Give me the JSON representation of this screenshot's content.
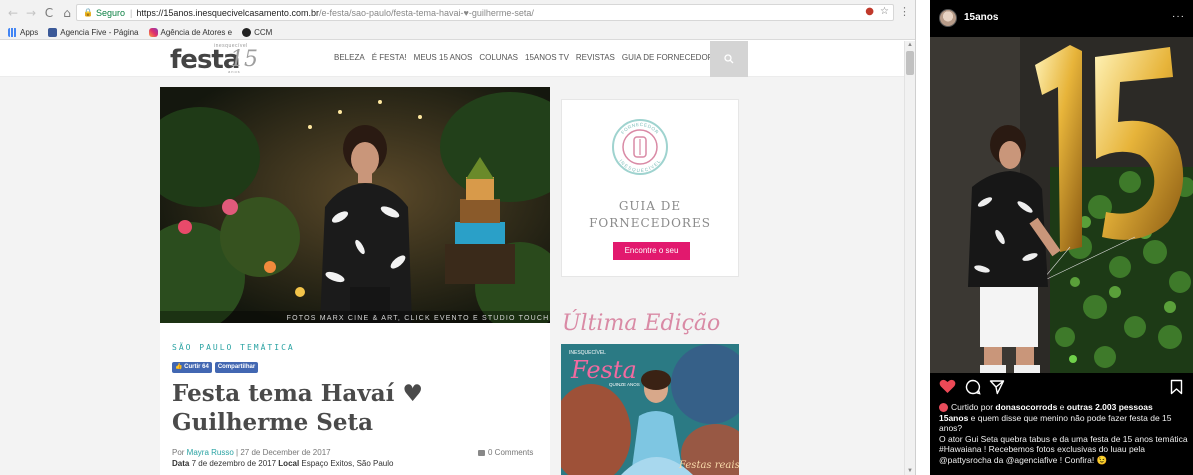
{
  "browser": {
    "nav": {
      "back": "←",
      "forward": "→",
      "reload": "C",
      "home": "⌂"
    },
    "omnibox": {
      "secure_label": "Seguro",
      "url_host": "https://15anos.inesquecivelcasamento.com.br",
      "url_path": "/e-festa/sao-paulo/festa-tema-havai-♥-guilherme-seta/"
    },
    "bookmarks": [
      {
        "label": "Apps",
        "icon": "apps-grid-icon"
      },
      {
        "label": "Agencia Five - Página",
        "icon": "facebook-icon"
      },
      {
        "label": "Agência de Atores e",
        "icon": "instagram-icon"
      },
      {
        "label": "CCM",
        "icon": "ccm-icon"
      }
    ]
  },
  "site": {
    "logo": {
      "small": "inesquecível",
      "main": "festa",
      "number": "15",
      "sub": "anos"
    },
    "nav": [
      "BELEZA",
      "É FESTA!",
      "MEUS 15 ANOS",
      "COLUNAS",
      "15ANOS TV",
      "REVISTAS",
      "GUIA DE FORNECEDORES"
    ],
    "hero_credit": "FOTOS MARX CINE & ART, CLICK EVENTO E STUDIO TOUCH",
    "article": {
      "categories": "SÃO PAULO TEMÁTICA",
      "like_label": "Curtir 64",
      "share_label": "Compartilhar",
      "title": "Festa tema Havaí ♥ Guilherme Seta",
      "byline_prefix": "Por ",
      "author": "Mayra Russo",
      "date": " | 27 de December de 2017",
      "comments": "0 Comments",
      "details_label_date": "Data",
      "details_date": " 7 de dezembro de 2017 ",
      "details_label_local": "Local",
      "details_local": " Espaço Exitos, São Paulo"
    },
    "sidebar": {
      "badge_text_top": "FORNECEDOR",
      "badge_text_bottom": "INESQUECÍVEL",
      "guia_line1": "GUIA DE",
      "guia_line2": "FORNECEDORES",
      "cta": "Encontre o seu",
      "ultima_edicao": "Última Edição",
      "magazine": {
        "small": "INESQUECÍVEL",
        "title": "Festa",
        "sub": "QUINZE ANOS",
        "footer": "Festas reais"
      }
    }
  },
  "instagram": {
    "username": "15anos",
    "more": "···",
    "liked_by_prefix": "Curtido por ",
    "liked_by_user": "donasocorrods",
    "liked_by_and": " e ",
    "liked_by_others": "outras 2.003 pessoas",
    "caption_user": "15anos",
    "caption_line1": " e quem disse que menino não pode fazer festa de 15 anos?",
    "caption_line2": "O ator Gui Seta quebra tabus e da uma festa de 15 anos temática #Hawaiana ! Recebemos fotos exclusivas do luau pela @pattysrocha da @agenciafive ! Confira! 😉"
  }
}
